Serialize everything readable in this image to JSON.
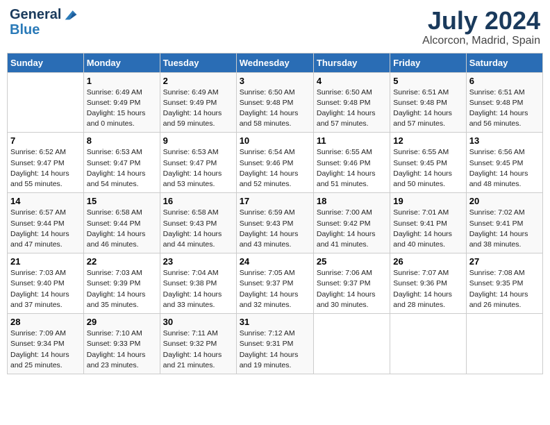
{
  "header": {
    "logo_general": "General",
    "logo_blue": "Blue",
    "month_year": "July 2024",
    "location": "Alcorcon, Madrid, Spain"
  },
  "weekdays": [
    "Sunday",
    "Monday",
    "Tuesday",
    "Wednesday",
    "Thursday",
    "Friday",
    "Saturday"
  ],
  "weeks": [
    [
      {
        "day": "",
        "info": ""
      },
      {
        "day": "1",
        "info": "Sunrise: 6:49 AM\nSunset: 9:49 PM\nDaylight: 15 hours\nand 0 minutes."
      },
      {
        "day": "2",
        "info": "Sunrise: 6:49 AM\nSunset: 9:49 PM\nDaylight: 14 hours\nand 59 minutes."
      },
      {
        "day": "3",
        "info": "Sunrise: 6:50 AM\nSunset: 9:48 PM\nDaylight: 14 hours\nand 58 minutes."
      },
      {
        "day": "4",
        "info": "Sunrise: 6:50 AM\nSunset: 9:48 PM\nDaylight: 14 hours\nand 57 minutes."
      },
      {
        "day": "5",
        "info": "Sunrise: 6:51 AM\nSunset: 9:48 PM\nDaylight: 14 hours\nand 57 minutes."
      },
      {
        "day": "6",
        "info": "Sunrise: 6:51 AM\nSunset: 9:48 PM\nDaylight: 14 hours\nand 56 minutes."
      }
    ],
    [
      {
        "day": "7",
        "info": "Sunrise: 6:52 AM\nSunset: 9:47 PM\nDaylight: 14 hours\nand 55 minutes."
      },
      {
        "day": "8",
        "info": "Sunrise: 6:53 AM\nSunset: 9:47 PM\nDaylight: 14 hours\nand 54 minutes."
      },
      {
        "day": "9",
        "info": "Sunrise: 6:53 AM\nSunset: 9:47 PM\nDaylight: 14 hours\nand 53 minutes."
      },
      {
        "day": "10",
        "info": "Sunrise: 6:54 AM\nSunset: 9:46 PM\nDaylight: 14 hours\nand 52 minutes."
      },
      {
        "day": "11",
        "info": "Sunrise: 6:55 AM\nSunset: 9:46 PM\nDaylight: 14 hours\nand 51 minutes."
      },
      {
        "day": "12",
        "info": "Sunrise: 6:55 AM\nSunset: 9:45 PM\nDaylight: 14 hours\nand 50 minutes."
      },
      {
        "day": "13",
        "info": "Sunrise: 6:56 AM\nSunset: 9:45 PM\nDaylight: 14 hours\nand 48 minutes."
      }
    ],
    [
      {
        "day": "14",
        "info": "Sunrise: 6:57 AM\nSunset: 9:44 PM\nDaylight: 14 hours\nand 47 minutes."
      },
      {
        "day": "15",
        "info": "Sunrise: 6:58 AM\nSunset: 9:44 PM\nDaylight: 14 hours\nand 46 minutes."
      },
      {
        "day": "16",
        "info": "Sunrise: 6:58 AM\nSunset: 9:43 PM\nDaylight: 14 hours\nand 44 minutes."
      },
      {
        "day": "17",
        "info": "Sunrise: 6:59 AM\nSunset: 9:43 PM\nDaylight: 14 hours\nand 43 minutes."
      },
      {
        "day": "18",
        "info": "Sunrise: 7:00 AM\nSunset: 9:42 PM\nDaylight: 14 hours\nand 41 minutes."
      },
      {
        "day": "19",
        "info": "Sunrise: 7:01 AM\nSunset: 9:41 PM\nDaylight: 14 hours\nand 40 minutes."
      },
      {
        "day": "20",
        "info": "Sunrise: 7:02 AM\nSunset: 9:41 PM\nDaylight: 14 hours\nand 38 minutes."
      }
    ],
    [
      {
        "day": "21",
        "info": "Sunrise: 7:03 AM\nSunset: 9:40 PM\nDaylight: 14 hours\nand 37 minutes."
      },
      {
        "day": "22",
        "info": "Sunrise: 7:03 AM\nSunset: 9:39 PM\nDaylight: 14 hours\nand 35 minutes."
      },
      {
        "day": "23",
        "info": "Sunrise: 7:04 AM\nSunset: 9:38 PM\nDaylight: 14 hours\nand 33 minutes."
      },
      {
        "day": "24",
        "info": "Sunrise: 7:05 AM\nSunset: 9:37 PM\nDaylight: 14 hours\nand 32 minutes."
      },
      {
        "day": "25",
        "info": "Sunrise: 7:06 AM\nSunset: 9:37 PM\nDaylight: 14 hours\nand 30 minutes."
      },
      {
        "day": "26",
        "info": "Sunrise: 7:07 AM\nSunset: 9:36 PM\nDaylight: 14 hours\nand 28 minutes."
      },
      {
        "day": "27",
        "info": "Sunrise: 7:08 AM\nSunset: 9:35 PM\nDaylight: 14 hours\nand 26 minutes."
      }
    ],
    [
      {
        "day": "28",
        "info": "Sunrise: 7:09 AM\nSunset: 9:34 PM\nDaylight: 14 hours\nand 25 minutes."
      },
      {
        "day": "29",
        "info": "Sunrise: 7:10 AM\nSunset: 9:33 PM\nDaylight: 14 hours\nand 23 minutes."
      },
      {
        "day": "30",
        "info": "Sunrise: 7:11 AM\nSunset: 9:32 PM\nDaylight: 14 hours\nand 21 minutes."
      },
      {
        "day": "31",
        "info": "Sunrise: 7:12 AM\nSunset: 9:31 PM\nDaylight: 14 hours\nand 19 minutes."
      },
      {
        "day": "",
        "info": ""
      },
      {
        "day": "",
        "info": ""
      },
      {
        "day": "",
        "info": ""
      }
    ]
  ]
}
